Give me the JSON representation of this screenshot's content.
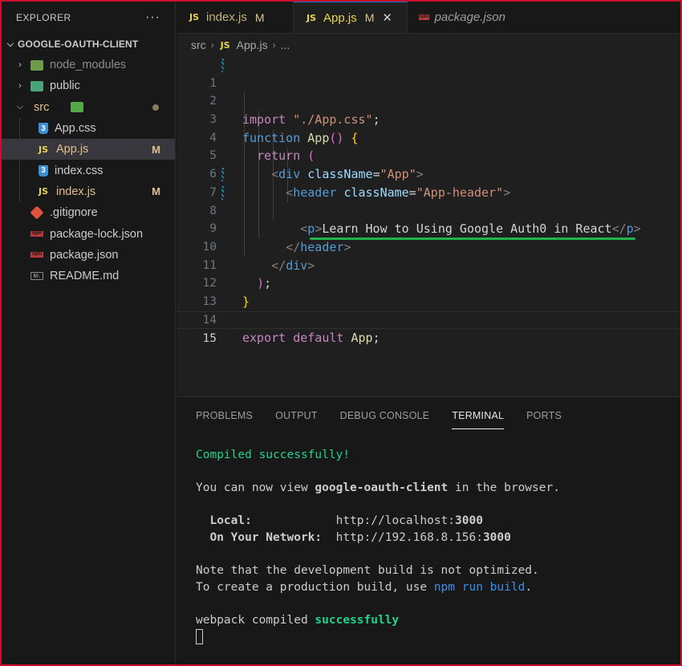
{
  "explorer": {
    "title": "EXPLORER",
    "more": "···",
    "project": "GOOGLE-OAUTH-CLIENT",
    "items": [
      {
        "label": "node_modules",
        "kind": "folder",
        "badge": ""
      },
      {
        "label": "public",
        "kind": "folder",
        "badge": ""
      },
      {
        "label": "src",
        "kind": "folder",
        "badge": ""
      },
      {
        "label": "App.css",
        "kind": "css",
        "badge": ""
      },
      {
        "label": "App.js",
        "kind": "js",
        "badge": "M"
      },
      {
        "label": "index.css",
        "kind": "css",
        "badge": ""
      },
      {
        "label": "index.js",
        "kind": "js",
        "badge": "M"
      },
      {
        "label": ".gitignore",
        "kind": "git",
        "badge": ""
      },
      {
        "label": "package-lock.json",
        "kind": "npm",
        "badge": ""
      },
      {
        "label": "package.json",
        "kind": "npm",
        "badge": ""
      },
      {
        "label": "README.md",
        "kind": "md",
        "badge": ""
      }
    ]
  },
  "icons": {
    "js": "JS",
    "css": "3",
    "npm": "npm",
    "md": "M↓"
  },
  "tabs": [
    {
      "label": "index.js",
      "badge": "M"
    },
    {
      "label": "App.js",
      "badge": "M",
      "close": "✕"
    },
    {
      "label": "package.json"
    }
  ],
  "breadcrumb": {
    "folder": "src",
    "file": "App.js",
    "more": "..."
  },
  "code": {
    "line_numbers": [
      "1",
      "2",
      "3",
      "4",
      "5",
      "6",
      "7",
      "8",
      "9",
      "10",
      "11",
      "12",
      "13",
      "14",
      "15"
    ],
    "l1": {
      "kw": "import",
      "str": "\"./App.css\"",
      "end": ";"
    },
    "l3": {
      "kw": "function",
      "name": "App",
      "parens": "()",
      "brace": "{"
    },
    "l4": {
      "kw": "return",
      "paren": "("
    },
    "l5": {
      "open": "<",
      "tag": "div",
      "attr": "className",
      "eq": "=",
      "val": "\"App\"",
      "close": ">"
    },
    "l6": {
      "open": "<",
      "tag": "header",
      "attr": "className",
      "eq": "=",
      "val": "\"App-header\"",
      "close": ">"
    },
    "l7": {
      "open": "<",
      "tag": "p",
      "close": ">",
      "text": "Learn How to Using Google Auth0 in React",
      "endopen": "</",
      "endtag": "p",
      "endclose": ">"
    },
    "l9": {
      "open": "</",
      "tag": "header",
      "close": ">"
    },
    "l10": {
      "open": "</",
      "tag": "div",
      "close": ">"
    },
    "l11": {
      "paren": ")",
      "semi": ";"
    },
    "l12": {
      "brace": "}"
    },
    "l14": {
      "kw1": "export",
      "kw2": "default",
      "name": "App",
      "semi": ";"
    }
  },
  "panel": {
    "tabs": [
      "PROBLEMS",
      "OUTPUT",
      "DEBUG CONSOLE",
      "TERMINAL",
      "PORTS"
    ],
    "active_tab": "TERMINAL"
  },
  "terminal": {
    "compiled": "Compiled successfully!",
    "view_prefix": "You can now view ",
    "app_name": "google-oauth-client",
    "view_suffix": " in the browser.",
    "local_label": "  Local:",
    "local_pad": "            ",
    "local_url": "http://localhost:",
    "local_port": "3000",
    "net_label": "  On Your Network:",
    "net_pad": "  ",
    "net_url": "http://192.168.8.156:",
    "net_port": "3000",
    "note1": "Note that the development build is not optimized.",
    "note2_prefix": "To create a production build, use ",
    "note2_cmd": "npm run build",
    "note2_suffix": ".",
    "webpack_prefix": "webpack compiled ",
    "webpack_status": "successfully"
  }
}
